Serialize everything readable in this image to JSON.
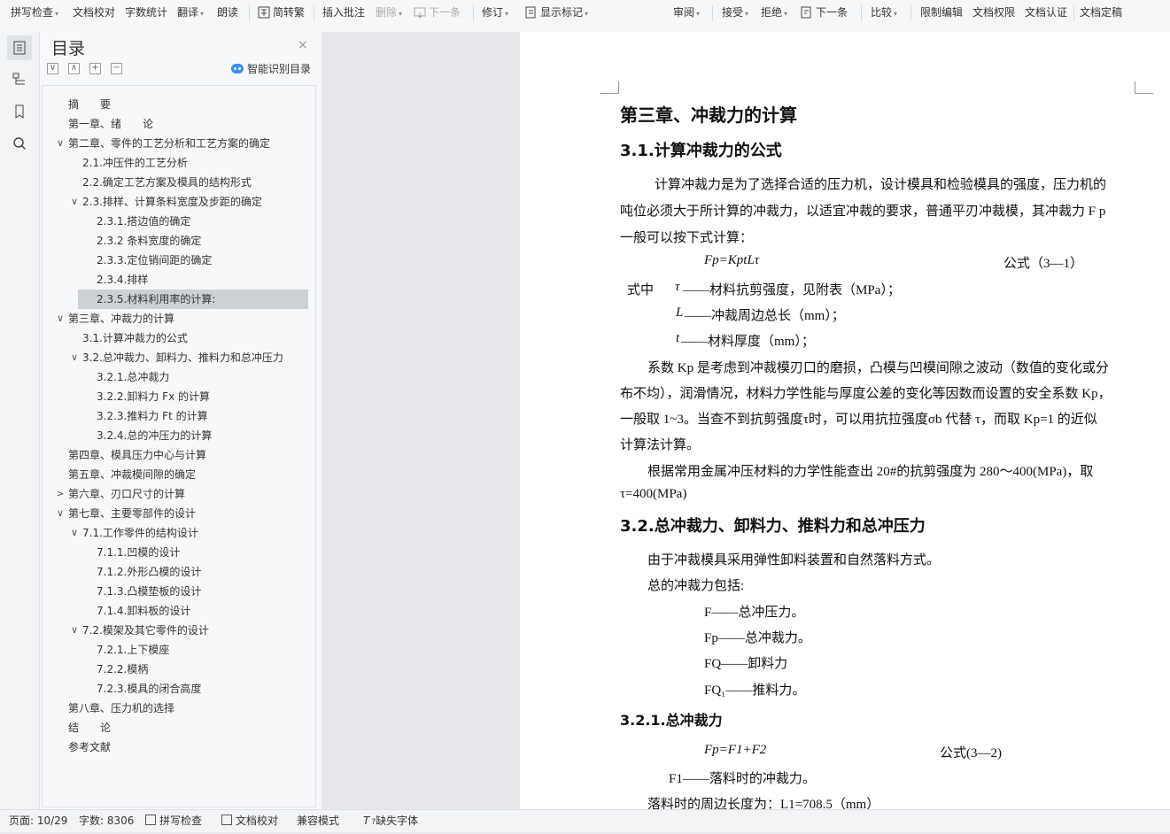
{
  "toolbar": {
    "left": [
      {
        "label": "拼写检查",
        "dd": "▾"
      },
      {
        "label": "文档校对"
      },
      {
        "label": "字数统计"
      },
      {
        "label": "翻译",
        "dd": "▾"
      },
      {
        "label": "朗读"
      },
      {
        "label": "简转繁"
      },
      {
        "label": "插入批注"
      },
      {
        "label": "删除",
        "dd": "▾",
        "disabled": true
      },
      {
        "label": "下一条",
        "disabled": true
      },
      {
        "label": "修订",
        "dd": "▾"
      },
      {
        "label": "显示标记",
        "dd": "▾"
      }
    ],
    "right": [
      {
        "label": "审阅",
        "dd": "▾"
      },
      {
        "label": "接受",
        "dd": "▾"
      },
      {
        "label": "拒绝",
        "dd": "▾"
      },
      {
        "label": "下一条"
      },
      {
        "label": "比较",
        "dd": "▾"
      },
      {
        "label": "限制编辑"
      },
      {
        "label": "文档权限"
      },
      {
        "label": "文档认证"
      },
      {
        "label": "文档定稿"
      }
    ]
  },
  "sidebar_icons": [
    "toc-icon",
    "navigation-icon",
    "bookmark-icon",
    "search-icon"
  ],
  "toc": {
    "title": "目录",
    "close": "×",
    "smart_label": "智能识别目录",
    "buttons": [
      "∨",
      "∧",
      "+",
      "−"
    ],
    "items": [
      {
        "level": 0,
        "text": "摘　　要"
      },
      {
        "level": 0,
        "text": "第一章、绪　　论"
      },
      {
        "level": 0,
        "text": "第二章、零件的工艺分析和工艺方案的确定",
        "toggle": "∨"
      },
      {
        "level": 1,
        "text": "2.1.冲压件的工艺分析"
      },
      {
        "level": 1,
        "text": "2.2.确定工艺方案及模具的结构形式"
      },
      {
        "level": 1,
        "text": "2.3.排样、计算条料宽度及步距的确定",
        "toggle": "∨"
      },
      {
        "level": 2,
        "text": "2.3.1.搭边值的确定"
      },
      {
        "level": 2,
        "text": "2.3.2 条料宽度的确定"
      },
      {
        "level": 2,
        "text": "2.3.3.定位销间距的确定"
      },
      {
        "level": 2,
        "text": "2.3.4.排样"
      },
      {
        "level": 2,
        "text": "2.3.5.材料利用率的计算:",
        "selected": true
      },
      {
        "level": 0,
        "text": "第三章、冲裁力的计算",
        "toggle": "∨"
      },
      {
        "level": 1,
        "text": "3.1.计算冲裁力的公式"
      },
      {
        "level": 1,
        "text": "3.2.总冲裁力、卸料力、推料力和总冲压力",
        "toggle": "∨"
      },
      {
        "level": 2,
        "text": "3.2.1.总冲裁力"
      },
      {
        "level": 2,
        "text": "3.2.2.卸料力 Fx 的计算"
      },
      {
        "level": 2,
        "text": "3.2.3.推料力 Ft 的计算"
      },
      {
        "level": 2,
        "text": "3.2.4.总的冲压力的计算"
      },
      {
        "level": 0,
        "text": "第四章、模具压力中心与计算"
      },
      {
        "level": 0,
        "text": "第五章、冲裁模间隙的确定"
      },
      {
        "level": 0,
        "text": "第六章、刃口尺寸的计算",
        "toggle": ">"
      },
      {
        "level": 0,
        "text": "第七章、主要零部件的设计",
        "toggle": "∨"
      },
      {
        "level": 1,
        "text": "7.1.工作零件的结构设计",
        "toggle": "∨"
      },
      {
        "level": 2,
        "text": "7.1.1.凹模的设计"
      },
      {
        "level": 2,
        "text": "7.1.2.外形凸模的设计"
      },
      {
        "level": 2,
        "text": "7.1.3.凸模垫板的设计"
      },
      {
        "level": 2,
        "text": "7.1.4.卸料板的设计"
      },
      {
        "level": 1,
        "text": "7.2.模架及其它零件的设计",
        "toggle": "∨"
      },
      {
        "level": 2,
        "text": "7.2.1.上下模座"
      },
      {
        "level": 2,
        "text": "7.2.2.模柄"
      },
      {
        "level": 2,
        "text": "7.2.3.模具的闭合高度"
      },
      {
        "level": 0,
        "text": "第八章、压力机的选择"
      },
      {
        "level": 0,
        "text": "结　　论"
      },
      {
        "level": 0,
        "text": "参考文献"
      }
    ]
  },
  "document": {
    "chapter_title": "第三章、冲裁力的计算",
    "s31_title": "3.1.计算冲裁力的公式",
    "p1_l1": "计算冲裁力是为了选择合适的压力机，设计模具和检验模具的强度，压力机的",
    "p1_l2": "吨位必须大于所计算的冲裁力，以适宜冲裁的要求，普通平刃冲裁模，其冲裁力 F p",
    "p1_l3": "一般可以按下式计算：",
    "formula1": "Fp=KptLτ",
    "formula1_tag": "公式（3—1）",
    "where_label": "式中",
    "def_tau_sym": "τ",
    "def_tau": "——材料抗剪强度，见附表（MPa）；",
    "def_L_sym": "L",
    "def_L": "——冲裁周边总长（mm）；",
    "def_t_sym": "t",
    "def_t": "——材料厚度（mm）；",
    "p2_l1": "系数 Kp 是考虑到冲裁模刃口的磨损，凸模与凹模间隙之波动（数值的变化或分",
    "p2_l2": "布不均），润滑情况，材料力学性能与厚度公差的变化等因数而设置的安全系数 Kp，",
    "p2_l3": "一般取 1~3。当查不到抗剪强度τ时，可以用抗拉强度σb 代替 τ，而取 Kp=1 的近似",
    "p2_l4": "计算法计算。",
    "p3_l1": "根据常用金属冲压材料的力学性能查出 20#的抗剪强度为 280～400(MPa)，取",
    "p3_l2": "τ=400(MPa)",
    "s32_title": "3.2.总冲裁力、卸料力、推料力和总冲压力",
    "p4": "由于冲裁模具采用弹性卸料装置和自然落料方式。",
    "p5": "总的冲裁力包括:",
    "list1": "F——总冲压力。",
    "list2": "Fp——总冲裁力。",
    "list3": "FQ——卸料力",
    "list4": "FQ₁——推料力。",
    "s321_title": "3.2.1.总冲裁力",
    "formula2": "Fp=F1+F2",
    "formula2_tag": "公式(3—2)",
    "f1_def": "F1——落料时的冲裁力。",
    "p6": "落料时的周边长度为：L1=708.5（mm）"
  },
  "status": {
    "page": "页面: 10/29",
    "words": "字数: 8306",
    "spell": "拼写检查",
    "proof": "文档校对",
    "compat": "兼容模式",
    "missing_font": "缺失字体"
  }
}
